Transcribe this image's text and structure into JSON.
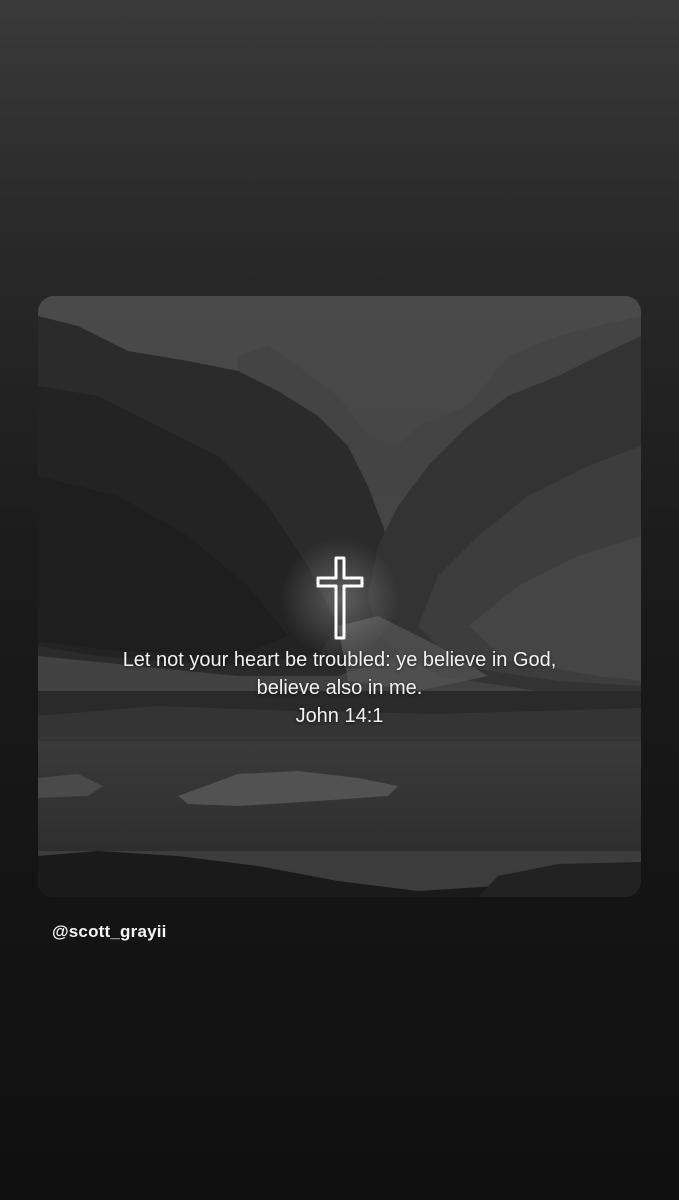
{
  "post": {
    "verse_line_1": "Let not your heart be troubled: ye believe in God,",
    "verse_line_2": "believe also in me.",
    "reference": "John 14:1",
    "image_icon": "cross-icon"
  },
  "mention": {
    "username": "@scott_grayii"
  },
  "colors": {
    "background_top": "#3a3a3a",
    "background_bottom": "#101010",
    "text": "#f2f2f2"
  }
}
